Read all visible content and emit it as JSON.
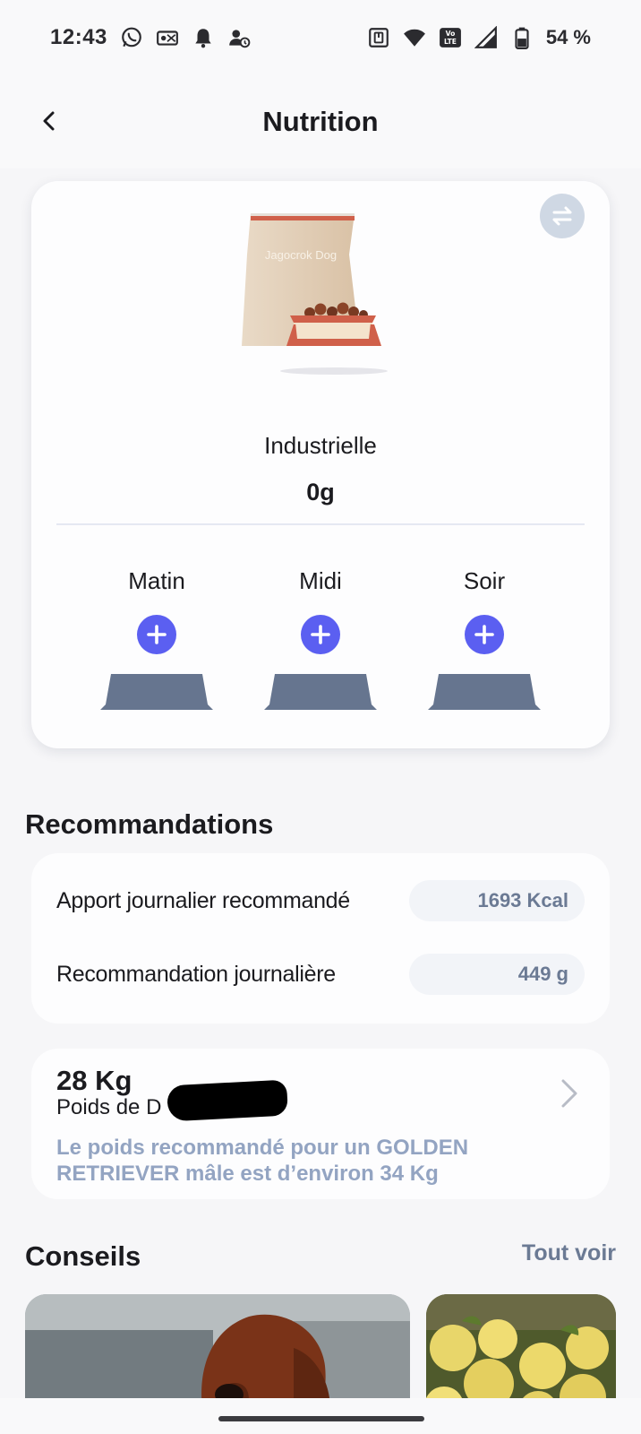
{
  "status_bar": {
    "time": "12:43",
    "battery": "54 %",
    "left_icons": [
      "whatsapp-icon",
      "voicemail-icon",
      "bell-icon",
      "alarm-icon"
    ],
    "right_icons": [
      "nfc-icon",
      "wifi-icon",
      "volte-icon",
      "signal-icon",
      "battery-icon"
    ]
  },
  "header": {
    "title": "Nutrition"
  },
  "food_card": {
    "bag_brand": "Jagocrok Dog",
    "type": "Industrielle",
    "amount": "0g",
    "meals": [
      {
        "label": "Matin"
      },
      {
        "label": "Midi"
      },
      {
        "label": "Soir"
      }
    ]
  },
  "recommendations": {
    "title": "Recommandations",
    "rows": [
      {
        "label": "Apport journalier recommandé",
        "value": "1693 Kcal"
      },
      {
        "label": "Recommandation journalière",
        "value": "449 g"
      }
    ]
  },
  "weight": {
    "value": "28 Kg",
    "label": "Poids de D",
    "note": "Le poids recommandé pour un GOLDEN RETRIEVER mâle est d’environ 34 Kg"
  },
  "tips": {
    "title": "Conseils",
    "see_all": "Tout voir"
  },
  "colors": {
    "accent": "#5b5ff1",
    "bowl": "#66758f",
    "muted_text": "#6b7a94",
    "note_text": "#93a4c2",
    "swap_button": "#cfd8e4",
    "bag_stripe": "#d0604a"
  }
}
